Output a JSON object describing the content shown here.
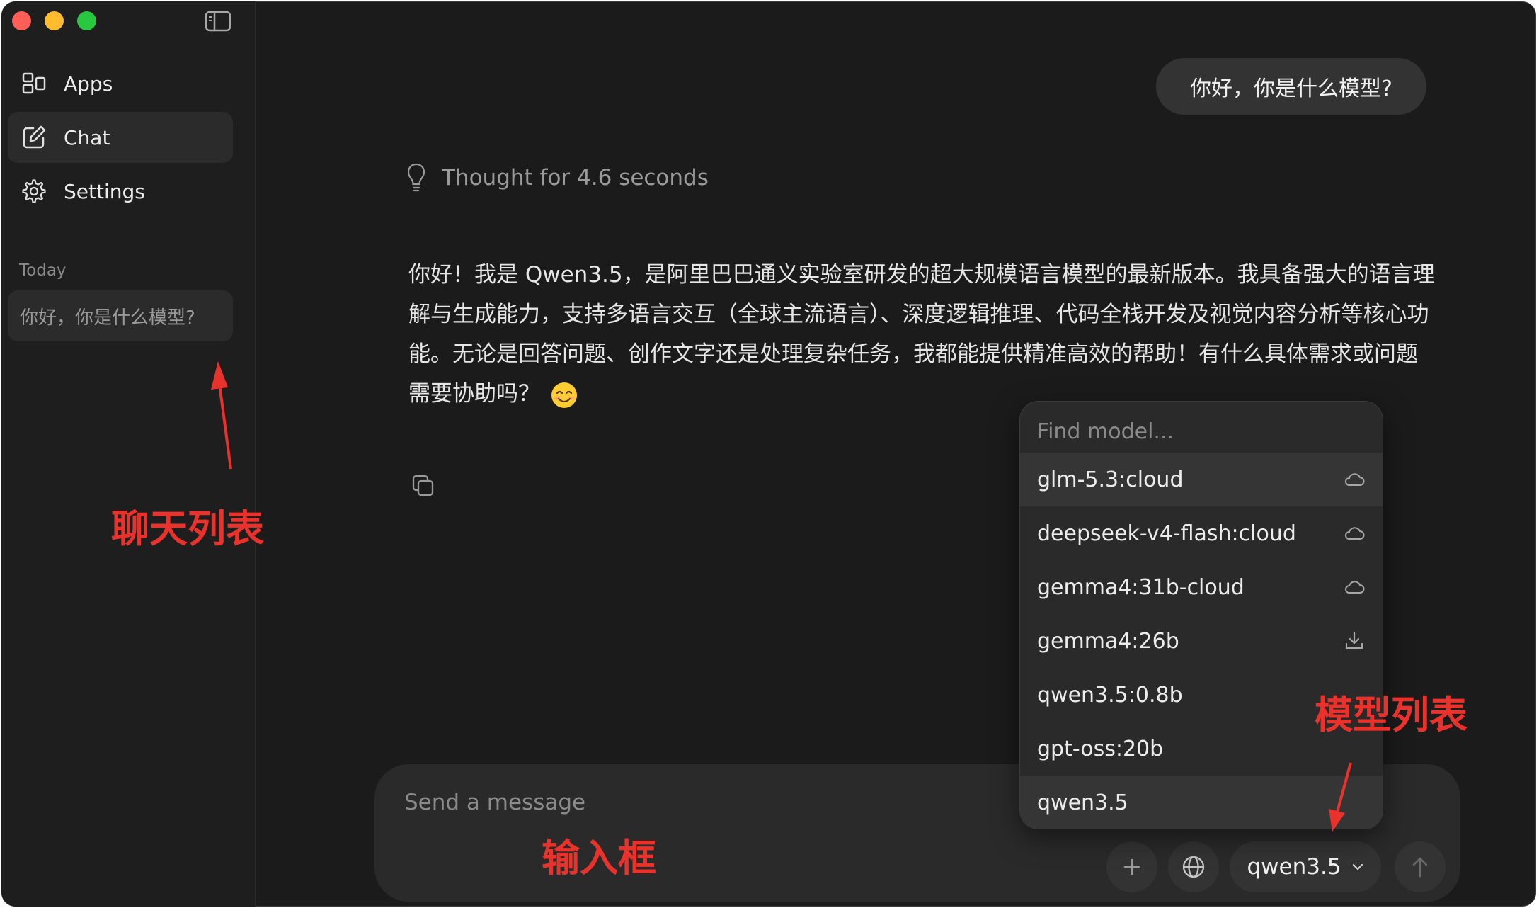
{
  "sidebar": {
    "nav": [
      {
        "label": "Apps",
        "icon": "apps-icon"
      },
      {
        "label": "Chat",
        "icon": "new-chat-icon"
      },
      {
        "label": "Settings",
        "icon": "gear-icon"
      }
    ],
    "history_heading": "Today",
    "history_items": [
      "你好，你是什么模型?"
    ]
  },
  "chat": {
    "user_message": "你好，你是什么模型?",
    "thought_label": "Thought for 4.6 seconds",
    "assistant_message": "你好！我是 Qwen3.5，是阿里巴巴通义实验室研发的超大规模语言模型的最新版本。我具备强大的语言理解与生成能力，支持多语言交互（全球主流语言）、深度逻辑推理、代码全栈开发及视觉内容分析等核心功能。无论是回答问题、创作文字还是处理复杂任务，我都能提供精准高效的帮助！有什么具体需求或问题需要协助吗？",
    "emoji": "smiling-face-emoji"
  },
  "input": {
    "placeholder": "Send a message",
    "model": "qwen3.5"
  },
  "model_menu": {
    "search_placeholder": "Find model...",
    "items": [
      {
        "name": "glm-5.3:cloud",
        "icon": "cloud-icon"
      },
      {
        "name": "deepseek-v4-flash:cloud",
        "icon": "cloud-icon"
      },
      {
        "name": "gemma4:31b-cloud",
        "icon": "cloud-icon"
      },
      {
        "name": "gemma4:26b",
        "icon": "download-icon"
      },
      {
        "name": "qwen3.5:0.8b",
        "icon": ""
      },
      {
        "name": "gpt-oss:20b",
        "icon": ""
      },
      {
        "name": "qwen3.5",
        "icon": ""
      }
    ]
  },
  "annotations": {
    "chat_list": "聊天列表",
    "input_box": "输入框",
    "model_list": "模型列表"
  },
  "colors": {
    "annotation": "#e8322b",
    "window_bg": "#1b1b1b",
    "sidebar_bg": "#1e1e1e"
  }
}
